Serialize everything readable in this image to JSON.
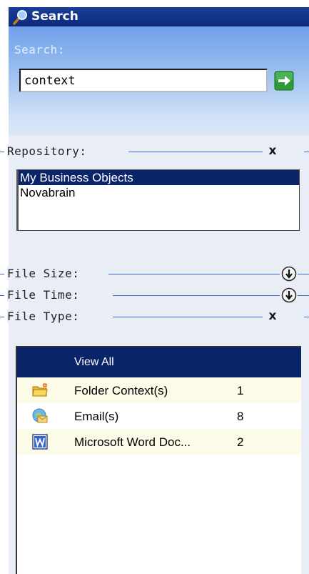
{
  "title": "Search",
  "search": {
    "label": "Search:",
    "value": "context"
  },
  "repository": {
    "label": "Repository:",
    "items": [
      {
        "label": "My Business Objects",
        "selected": true
      },
      {
        "label": "Novabrain",
        "selected": false
      }
    ]
  },
  "file_size": {
    "label": "File Size:"
  },
  "file_time": {
    "label": "File Time:"
  },
  "file_type": {
    "label": "File Type:",
    "header": "View All",
    "rows": [
      {
        "icon": "folder-icon",
        "name": "Folder Context(s)",
        "count": "1"
      },
      {
        "icon": "email-icon",
        "name": "Email(s)",
        "count": "8"
      },
      {
        "icon": "word-document-icon",
        "name": "Microsoft Word Doc...",
        "count": "2"
      }
    ]
  },
  "colors": {
    "title_bar": "#0c2a7a",
    "selection": "#0a246a",
    "section_line": "#3b6dcf",
    "row_alt": "#fbfbe7"
  }
}
